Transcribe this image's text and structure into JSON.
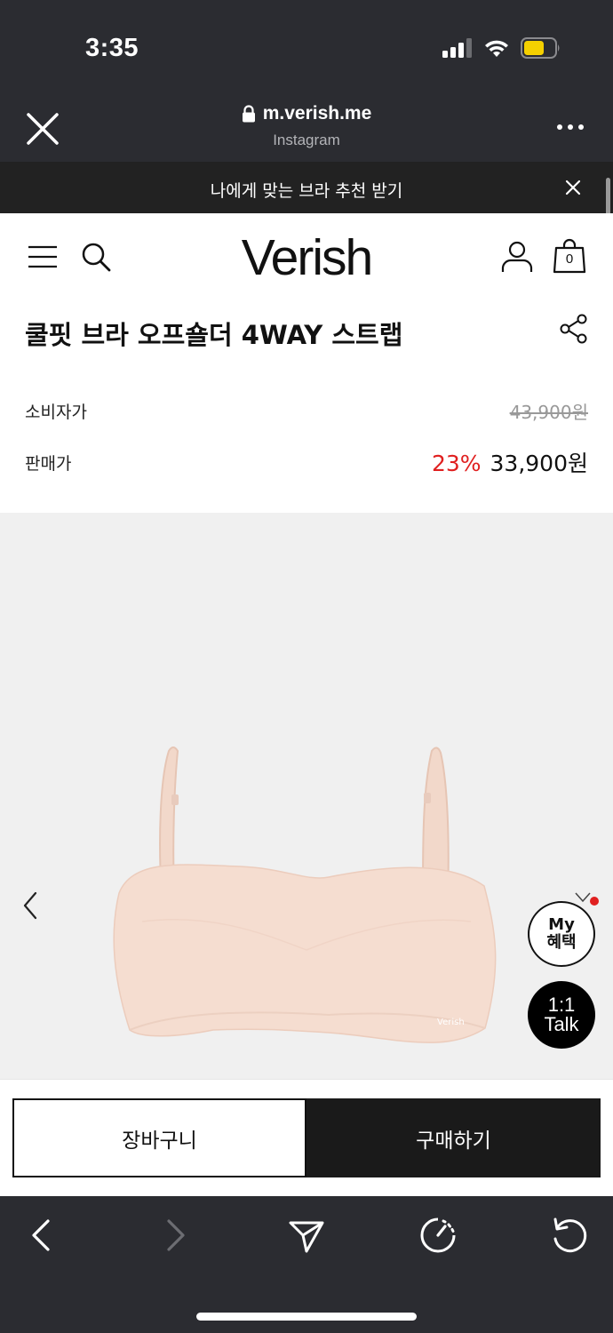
{
  "status_bar": {
    "time": "3:35",
    "icons": [
      "cellular-signal-icon",
      "wifi-icon",
      "battery-icon"
    ],
    "battery_color": "#f5d000"
  },
  "browser": {
    "url": "m.verish.me",
    "source": "Instagram",
    "icons": [
      "close-icon",
      "lock-icon",
      "more-icon"
    ]
  },
  "promo_banner": {
    "text": "나에게 맞는 브라 추천 받기"
  },
  "header": {
    "logo": "Verish",
    "cart_count": "0",
    "icons": [
      "menu-icon",
      "search-icon",
      "user-icon",
      "shopping-bag-icon"
    ]
  },
  "product": {
    "title": "쿨핏 브라 오프숄더 4WAY 스트랩",
    "consumer_price_label": "소비자가",
    "consumer_price": "43,900원",
    "sale_price_label": "판매가",
    "discount": "23%",
    "sale_price": "33,900원"
  },
  "gallery": {
    "icons": [
      "chevron-left-icon"
    ],
    "product_color": "#f5ddd0"
  },
  "floating": {
    "my_benefit_line1": "My",
    "my_benefit_line2": "혜택",
    "talk_line1": "1:1",
    "talk_line2": "Talk"
  },
  "actions": {
    "cart_label": "장바구니",
    "buy_label": "구매하기"
  },
  "browser_nav": {
    "icons": [
      "back-icon",
      "forward-icon",
      "share-send-icon",
      "speed-icon",
      "reload-icon"
    ]
  },
  "colors": {
    "dark_chrome": "#2b2c31",
    "discount_red": "#e02020",
    "buy_button": "#1a1a1a"
  }
}
